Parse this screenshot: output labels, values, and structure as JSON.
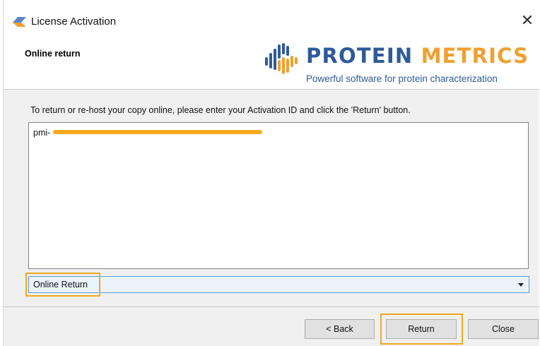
{
  "window": {
    "title": "License Activation",
    "close_icon": "close-icon",
    "app_icon": "license-key-icon"
  },
  "header": {
    "section_title": "Online return",
    "logo": {
      "name_part1": "PROTEIN",
      "name_part2": "METRICS",
      "tagline": "Powerful software for protein characterization"
    }
  },
  "main": {
    "instruction": "To return or re-host your copy online, please enter your Activation ID and click the 'Return' button.",
    "activation_id_prefix": "pmi-",
    "method_select": {
      "selected": "Online Return"
    }
  },
  "footer": {
    "back_label": "< Back",
    "return_label": "Return",
    "close_label": "Close"
  },
  "colors": {
    "highlight": "#f0a822",
    "logo_blue": "#2f5a9a",
    "logo_orange": "#f0a030",
    "redaction": "#f6aa1e"
  }
}
